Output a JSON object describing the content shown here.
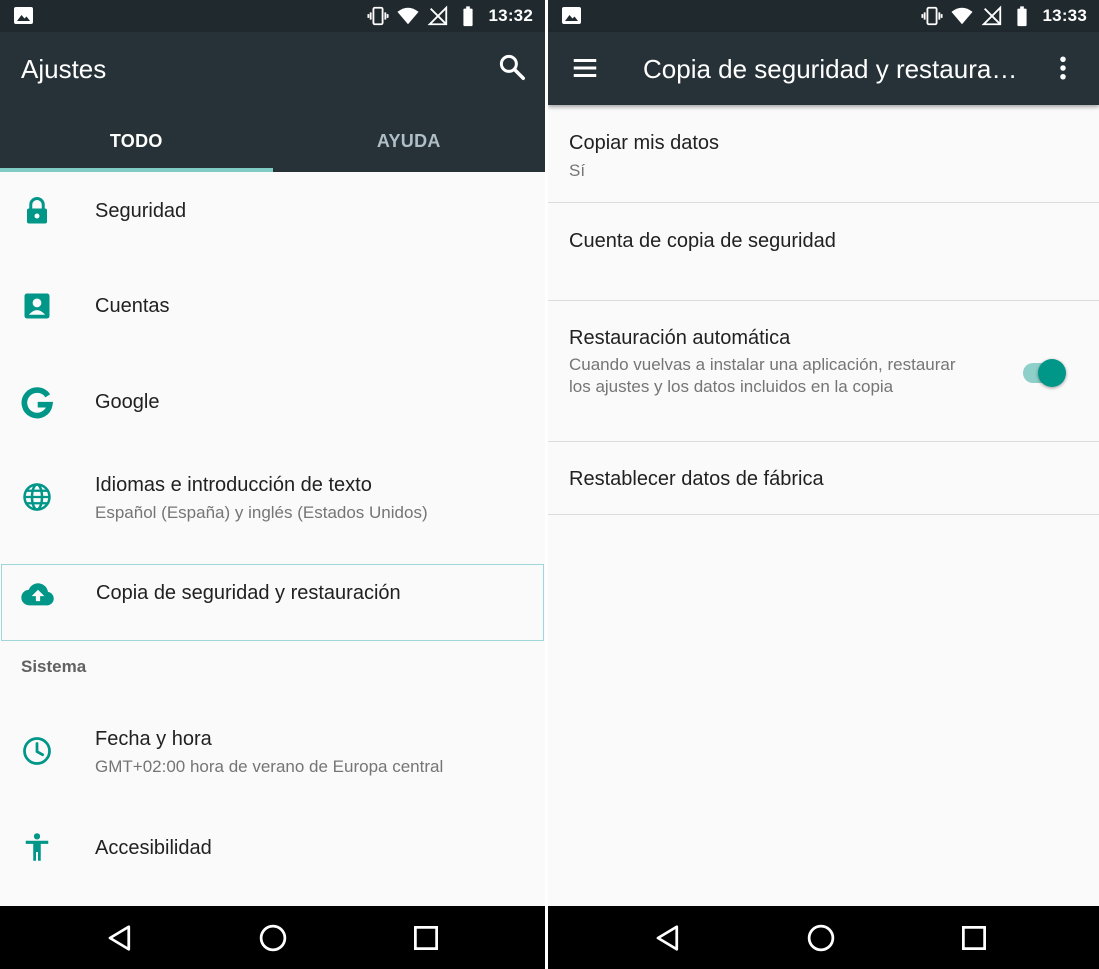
{
  "left_screen": {
    "status_bar": {
      "time": "13:32"
    },
    "app_bar": {
      "title": "Ajustes",
      "action_icon": "search-icon"
    },
    "tabs": [
      {
        "label": "TODO",
        "active": true
      },
      {
        "label": "AYUDA",
        "active": false
      }
    ],
    "items": [
      {
        "icon": "lock-icon",
        "title": "Seguridad"
      },
      {
        "icon": "account-box-icon",
        "title": "Cuentas"
      },
      {
        "icon": "google-icon",
        "title": "Google"
      },
      {
        "icon": "globe-icon",
        "title": "Idiomas e introducción de texto",
        "subtitle": "Español (España) y inglés (Estados Unidos)"
      },
      {
        "icon": "cloud-upload-icon",
        "title": "Copia de seguridad y restauración",
        "selected": true
      }
    ],
    "section_header": "Sistema",
    "system_items": [
      {
        "icon": "clock-icon",
        "title": "Fecha y hora",
        "subtitle": "GMT+02:00 hora de verano de Europa central"
      },
      {
        "icon": "accessibility-icon",
        "title": "Accesibilidad"
      }
    ]
  },
  "right_screen": {
    "status_bar": {
      "time": "13:33"
    },
    "app_bar": {
      "title": "Copia de seguridad y restauración",
      "nav_icon": "menu-icon",
      "action_icon": "more-vert-icon"
    },
    "preferences": [
      {
        "title": "Copiar mis datos",
        "subtitle": "Sí"
      },
      {
        "title": "Cuenta de copia de seguridad"
      },
      {
        "title": "Restauración automática",
        "subtitle": "Cuando vuelvas a instalar una aplicación, restaurar los ajustes y los datos incluidos en la copia",
        "switch_on": true
      },
      {
        "title": "Restablecer datos de fábrica"
      }
    ]
  },
  "colors": {
    "status_bar": "#1f292e",
    "app_bar": "#263238",
    "accent": "#009688",
    "tab_indicator": "#80cbc4",
    "background": "#fafafa"
  }
}
